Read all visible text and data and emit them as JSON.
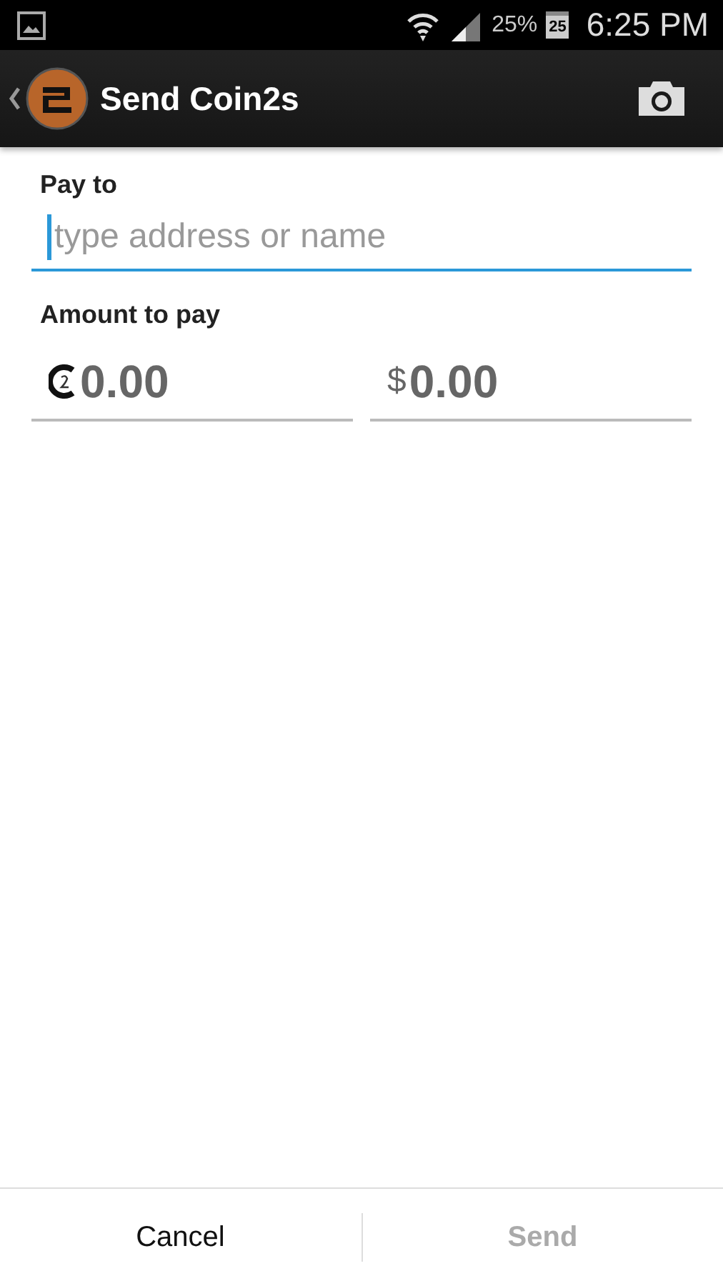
{
  "status_bar": {
    "battery": "25%",
    "calendar_day": "25",
    "time": "6:25 PM"
  },
  "action_bar": {
    "title": "Send Coin2s"
  },
  "pay_to": {
    "label": "Pay to",
    "placeholder": "type address or name",
    "focused": true
  },
  "amount": {
    "label": "Amount to pay",
    "fields": [
      {
        "kind": "coin",
        "placeholder": "0.00"
      },
      {
        "kind": "fiat",
        "prefix": "$",
        "placeholder": "0.00"
      }
    ]
  },
  "buttons": [
    {
      "label": "Cancel",
      "disabled": false
    },
    {
      "label": "Send",
      "disabled": true
    }
  ]
}
